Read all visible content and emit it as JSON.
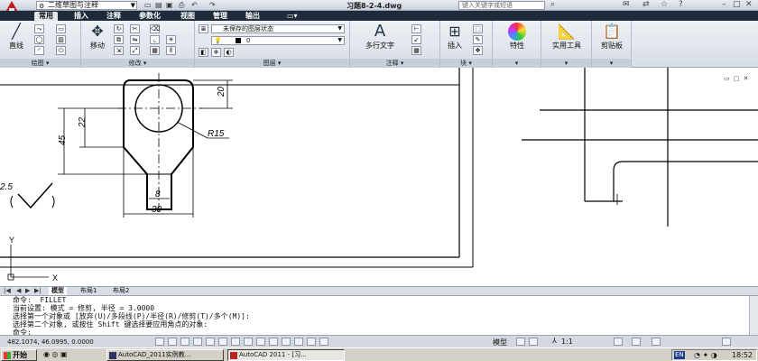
{
  "titlebar": {
    "workspace": "二维草图与注释",
    "doc_title": "习题8-2-4.dwg",
    "search_placeholder": "键入关键字或短语"
  },
  "tabs": [
    "常用",
    "插入",
    "注释",
    "参数化",
    "视图",
    "管理",
    "输出"
  ],
  "ribbon": {
    "draw": {
      "title": "绘图",
      "line_label": "直线"
    },
    "modify": {
      "title": "修改",
      "move_label": "移动"
    },
    "layers": {
      "title": "图层",
      "layer_state": "未保存的图层状态",
      "current_layer": "0"
    },
    "annotation": {
      "title": "注释",
      "mtext_label": "多行文字"
    },
    "block": {
      "title": "块",
      "insert_label": "插入"
    },
    "properties": {
      "label": "特性"
    },
    "utilities": {
      "label": "实用工具"
    },
    "clipboard": {
      "label": "剪贴板"
    }
  },
  "drawing": {
    "dims": {
      "d20": "20",
      "d22": "22",
      "d45": "45",
      "r15": "R15",
      "d8": "8",
      "d30": "30",
      "partial": "2.5"
    },
    "ucs": {
      "y": "Y",
      "x": "X"
    }
  },
  "layout_tabs": [
    "模型",
    "布局1",
    "布局2"
  ],
  "cmdline": {
    "lines": [
      "命令:  FILLET",
      "当前设置: 模式 = 修剪, 半径 = 3.0000",
      "选择第一个对象或 [放弃(U)/多段线(P)/半径(R)/修剪(T)/多个(M)]:",
      "选择第二个对象, 或按住 Shift 键选择要应用角点的对象:",
      "命令:"
    ]
  },
  "statusbar": {
    "coords": "482.1074, 46.0995, 0.0000",
    "model": "模型",
    "scale": "1:1"
  },
  "taskbar": {
    "start": "开始",
    "tasks": [
      "AutoCAD_2011实例教...",
      "AutoCAD 2011 - [习..."
    ],
    "ime": "EN",
    "clock": "18:52"
  },
  "colors": {
    "title_red": "#c21c1c",
    "tabbar": "#1f2a3a",
    "canvas": "#ffffff"
  }
}
